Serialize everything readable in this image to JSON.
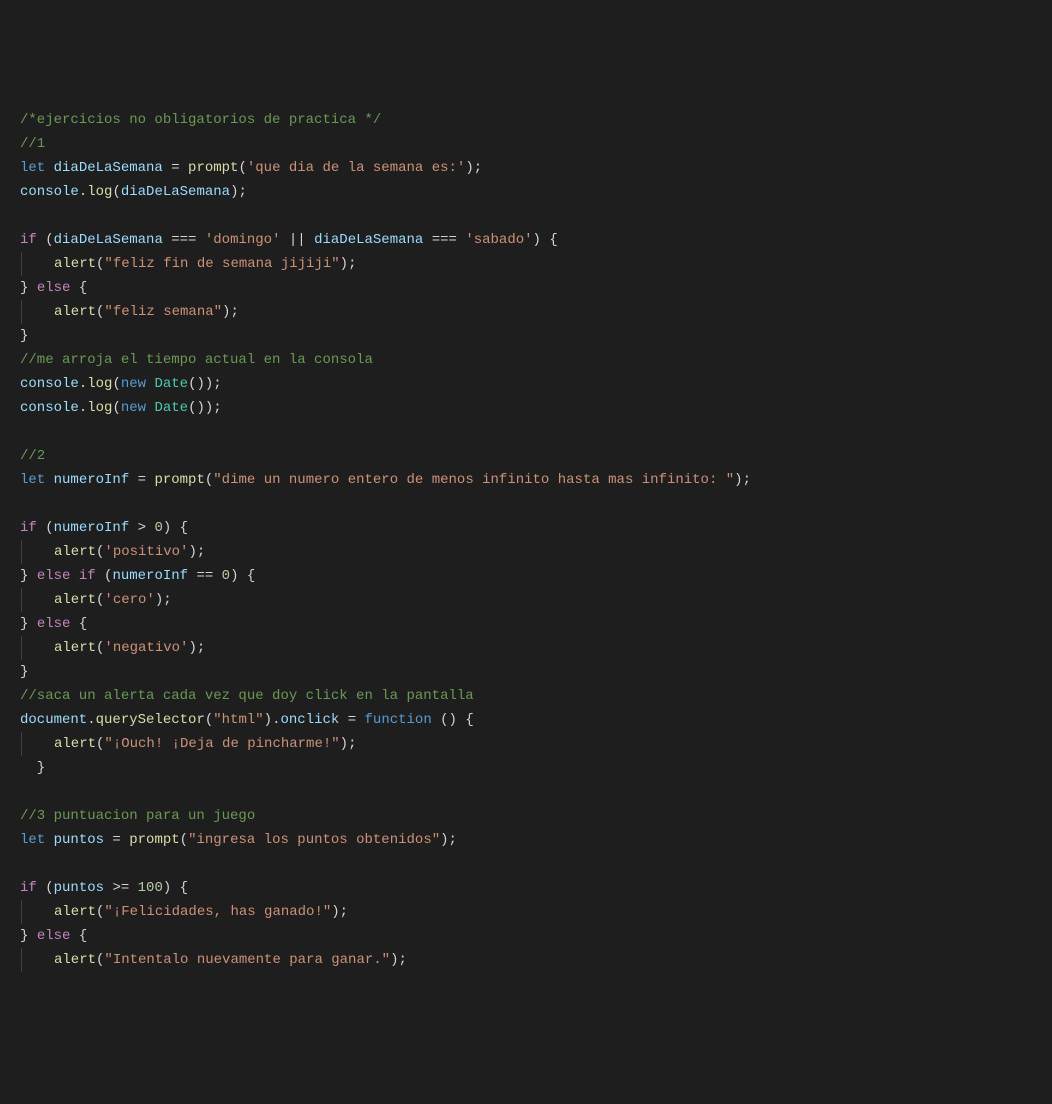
{
  "lines": [
    [
      {
        "t": "/*ejercicios no obligatorios de practica */",
        "c": "c-comment"
      }
    ],
    [
      {
        "t": "//1",
        "c": "c-comment"
      }
    ],
    [
      {
        "t": "let ",
        "c": "c-keyword"
      },
      {
        "t": "diaDeLaSemana",
        "c": "c-var"
      },
      {
        "t": " = ",
        "c": "c-punct"
      },
      {
        "t": "prompt",
        "c": "c-func"
      },
      {
        "t": "(",
        "c": "c-punct"
      },
      {
        "t": "'que dia de la semana es:'",
        "c": "c-string"
      },
      {
        "t": ");",
        "c": "c-punct"
      }
    ],
    [
      {
        "t": "console",
        "c": "c-var"
      },
      {
        "t": ".",
        "c": "c-punct"
      },
      {
        "t": "log",
        "c": "c-func"
      },
      {
        "t": "(",
        "c": "c-punct"
      },
      {
        "t": "diaDeLaSemana",
        "c": "c-var"
      },
      {
        "t": ");",
        "c": "c-punct"
      }
    ],
    [],
    [
      {
        "t": "if",
        "c": "c-ctrl"
      },
      {
        "t": " (",
        "c": "c-punct"
      },
      {
        "t": "diaDeLaSemana",
        "c": "c-var"
      },
      {
        "t": " === ",
        "c": "c-punct"
      },
      {
        "t": "'domingo'",
        "c": "c-string"
      },
      {
        "t": " || ",
        "c": "c-punct"
      },
      {
        "t": "diaDeLaSemana",
        "c": "c-var"
      },
      {
        "t": " === ",
        "c": "c-punct"
      },
      {
        "t": "'sabado'",
        "c": "c-string"
      },
      {
        "t": ") {",
        "c": "c-punct"
      }
    ],
    [
      {
        "g": true
      },
      {
        "t": "alert",
        "c": "c-func"
      },
      {
        "t": "(",
        "c": "c-punct"
      },
      {
        "t": "\"feliz fin de semana jijiji\"",
        "c": "c-string"
      },
      {
        "t": ");",
        "c": "c-punct"
      }
    ],
    [
      {
        "t": "} ",
        "c": "c-punct"
      },
      {
        "t": "else",
        "c": "c-ctrl"
      },
      {
        "t": " {",
        "c": "c-punct"
      }
    ],
    [
      {
        "g": true
      },
      {
        "t": "alert",
        "c": "c-func"
      },
      {
        "t": "(",
        "c": "c-punct"
      },
      {
        "t": "\"feliz semana\"",
        "c": "c-string"
      },
      {
        "t": ");",
        "c": "c-punct"
      }
    ],
    [
      {
        "t": "}",
        "c": "c-punct"
      }
    ],
    [
      {
        "t": "//me arroja el tiempo actual en la consola",
        "c": "c-comment"
      }
    ],
    [
      {
        "t": "console",
        "c": "c-var"
      },
      {
        "t": ".",
        "c": "c-punct"
      },
      {
        "t": "log",
        "c": "c-func"
      },
      {
        "t": "(",
        "c": "c-punct"
      },
      {
        "t": "new ",
        "c": "c-keyword"
      },
      {
        "t": "Date",
        "c": "c-class"
      },
      {
        "t": "());",
        "c": "c-punct"
      }
    ],
    [
      {
        "t": "console",
        "c": "c-var"
      },
      {
        "t": ".",
        "c": "c-punct"
      },
      {
        "t": "log",
        "c": "c-func"
      },
      {
        "t": "(",
        "c": "c-punct"
      },
      {
        "t": "new ",
        "c": "c-keyword"
      },
      {
        "t": "Date",
        "c": "c-class"
      },
      {
        "t": "());",
        "c": "c-punct"
      }
    ],
    [],
    [
      {
        "t": "//2",
        "c": "c-comment"
      }
    ],
    [
      {
        "t": "let ",
        "c": "c-keyword"
      },
      {
        "t": "numeroInf",
        "c": "c-var"
      },
      {
        "t": " = ",
        "c": "c-punct"
      },
      {
        "t": "prompt",
        "c": "c-func"
      },
      {
        "t": "(",
        "c": "c-punct"
      },
      {
        "t": "\"dime un numero entero de menos infinito hasta mas infinito: \"",
        "c": "c-string"
      },
      {
        "t": ");",
        "c": "c-punct"
      }
    ],
    [],
    [
      {
        "t": "if",
        "c": "c-ctrl"
      },
      {
        "t": " (",
        "c": "c-punct"
      },
      {
        "t": "numeroInf",
        "c": "c-var"
      },
      {
        "t": " > ",
        "c": "c-punct"
      },
      {
        "t": "0",
        "c": "c-num"
      },
      {
        "t": ") {",
        "c": "c-punct"
      }
    ],
    [
      {
        "g": true
      },
      {
        "t": "alert",
        "c": "c-func"
      },
      {
        "t": "(",
        "c": "c-punct"
      },
      {
        "t": "'positivo'",
        "c": "c-string"
      },
      {
        "t": ");",
        "c": "c-punct"
      }
    ],
    [
      {
        "t": "} ",
        "c": "c-punct"
      },
      {
        "t": "else if",
        "c": "c-ctrl"
      },
      {
        "t": " (",
        "c": "c-punct"
      },
      {
        "t": "numeroInf",
        "c": "c-var"
      },
      {
        "t": " == ",
        "c": "c-punct"
      },
      {
        "t": "0",
        "c": "c-num"
      },
      {
        "t": ") {",
        "c": "c-punct"
      }
    ],
    [
      {
        "g": true
      },
      {
        "t": "alert",
        "c": "c-func"
      },
      {
        "t": "(",
        "c": "c-punct"
      },
      {
        "t": "'cero'",
        "c": "c-string"
      },
      {
        "t": ");",
        "c": "c-punct"
      }
    ],
    [
      {
        "t": "} ",
        "c": "c-punct"
      },
      {
        "t": "else",
        "c": "c-ctrl"
      },
      {
        "t": " {",
        "c": "c-punct"
      }
    ],
    [
      {
        "g": true
      },
      {
        "t": "alert",
        "c": "c-func"
      },
      {
        "t": "(",
        "c": "c-punct"
      },
      {
        "t": "'negativo'",
        "c": "c-string"
      },
      {
        "t": ");",
        "c": "c-punct"
      }
    ],
    [
      {
        "t": "}",
        "c": "c-punct"
      }
    ],
    [
      {
        "t": "//saca un alerta cada vez que doy click en la pantalla",
        "c": "c-comment"
      }
    ],
    [
      {
        "t": "document",
        "c": "c-var"
      },
      {
        "t": ".",
        "c": "c-punct"
      },
      {
        "t": "querySelector",
        "c": "c-func"
      },
      {
        "t": "(",
        "c": "c-punct"
      },
      {
        "t": "\"html\"",
        "c": "c-string"
      },
      {
        "t": ").",
        "c": "c-punct"
      },
      {
        "t": "onclick",
        "c": "c-var"
      },
      {
        "t": " = ",
        "c": "c-punct"
      },
      {
        "t": "function",
        "c": "c-keyword"
      },
      {
        "t": " () {",
        "c": "c-punct"
      }
    ],
    [
      {
        "g": true
      },
      {
        "t": "alert",
        "c": "c-func"
      },
      {
        "t": "(",
        "c": "c-punct"
      },
      {
        "t": "\"¡Ouch! ¡Deja de pincharme!\"",
        "c": "c-string"
      },
      {
        "t": ");",
        "c": "c-punct"
      }
    ],
    [
      {
        "t": "  }",
        "c": "c-punct"
      }
    ],
    [],
    [
      {
        "t": "//3 puntuacion para un juego",
        "c": "c-comment"
      }
    ],
    [
      {
        "t": "let ",
        "c": "c-keyword"
      },
      {
        "t": "puntos",
        "c": "c-var"
      },
      {
        "t": " = ",
        "c": "c-punct"
      },
      {
        "t": "prompt",
        "c": "c-func"
      },
      {
        "t": "(",
        "c": "c-punct"
      },
      {
        "t": "\"ingresa los puntos obtenidos\"",
        "c": "c-string"
      },
      {
        "t": ");",
        "c": "c-punct"
      }
    ],
    [],
    [
      {
        "t": "if",
        "c": "c-ctrl"
      },
      {
        "t": " (",
        "c": "c-punct"
      },
      {
        "t": "puntos",
        "c": "c-var"
      },
      {
        "t": " >= ",
        "c": "c-punct"
      },
      {
        "t": "100",
        "c": "c-num"
      },
      {
        "t": ") {",
        "c": "c-punct"
      }
    ],
    [
      {
        "g": true
      },
      {
        "t": "alert",
        "c": "c-func"
      },
      {
        "t": "(",
        "c": "c-punct"
      },
      {
        "t": "\"¡Felicidades, has ganado!\"",
        "c": "c-string"
      },
      {
        "t": ");",
        "c": "c-punct"
      }
    ],
    [
      {
        "t": "} ",
        "c": "c-punct"
      },
      {
        "t": "else",
        "c": "c-ctrl"
      },
      {
        "t": " {",
        "c": "c-punct"
      }
    ],
    [
      {
        "g": true
      },
      {
        "t": "alert",
        "c": "c-func"
      },
      {
        "t": "(",
        "c": "c-punct"
      },
      {
        "t": "\"Intentalo nuevamente para ganar.\"",
        "c": "c-string"
      },
      {
        "t": ");",
        "c": "c-punct"
      }
    ]
  ]
}
